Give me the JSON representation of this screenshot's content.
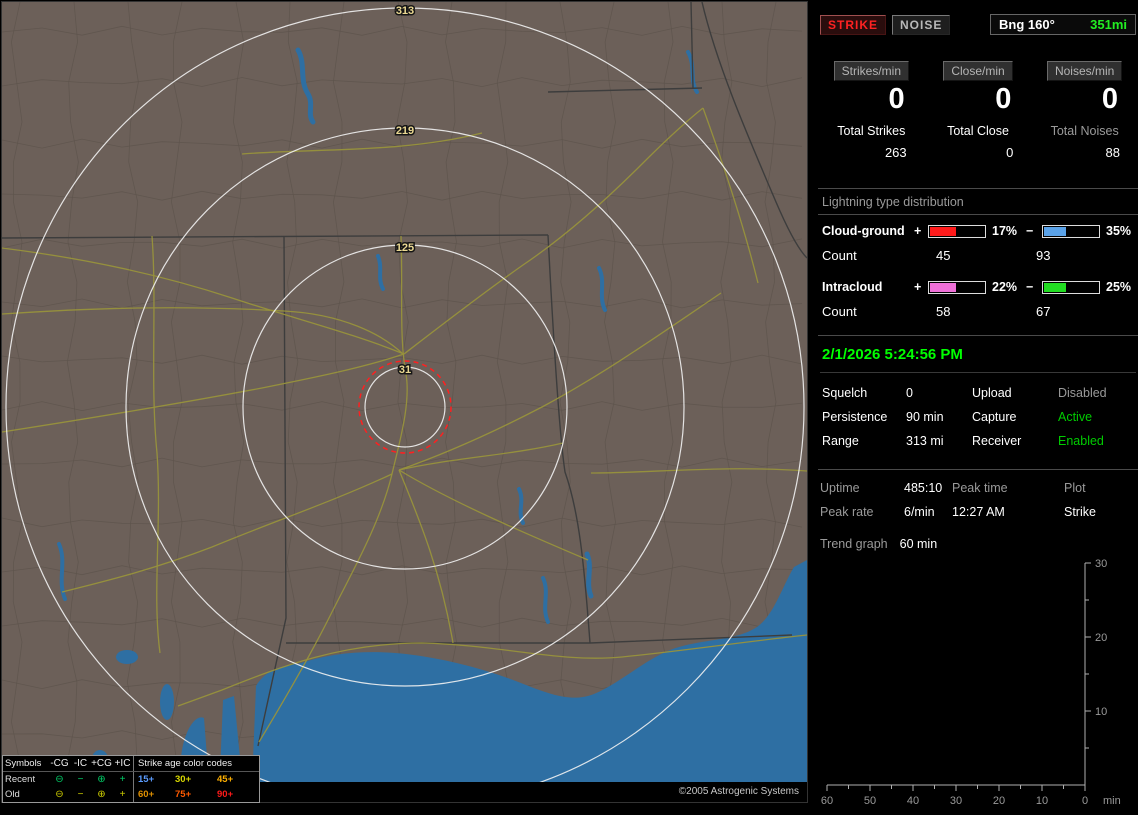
{
  "map": {
    "ring_labels": [
      "313",
      "219",
      "125",
      "31"
    ],
    "copyright": "©2005 Astrogenic Systems"
  },
  "legend": {
    "header_symbols": "Symbols",
    "symbol_cols": [
      "-CG",
      "-IC",
      "+CG",
      "+IC"
    ],
    "header_age": "Strike age color codes",
    "recent_color": "#00cc66",
    "old_color": "#cccc00",
    "rows": [
      {
        "label": "Recent",
        "symbols": [
          "⊖",
          "−",
          "⊕",
          "+"
        ],
        "ages": [
          {
            "t": "15+",
            "c": "#5a9cff"
          },
          {
            "t": "30+",
            "c": "#d8d800"
          },
          {
            "t": "45+",
            "c": "#ffb000"
          }
        ]
      },
      {
        "label": "Old",
        "symbols": [
          "⊖",
          "−",
          "⊕",
          "+"
        ],
        "ages": [
          {
            "t": "60+",
            "c": "#e09000"
          },
          {
            "t": "75+",
            "c": "#ff5a00"
          },
          {
            "t": "90+",
            "c": "#ff1a1a"
          }
        ]
      }
    ]
  },
  "panel": {
    "mode_buttons": {
      "strike": "STRIKE",
      "noise": "NOISE"
    },
    "bearing": {
      "label": "Bng 160°",
      "distance": "351mi"
    },
    "rates": [
      {
        "label": "Strikes/min",
        "value": "0",
        "total_label": "Total Strikes",
        "total_value": "263",
        "label_color": "#ffffff"
      },
      {
        "label": "Close/min",
        "value": "0",
        "total_label": "Total Close",
        "total_value": "0",
        "label_color": "#ffffff"
      },
      {
        "label": "Noises/min",
        "value": "0",
        "total_label": "Total Noises",
        "total_value": "88",
        "label_color": "#9a9a9a"
      }
    ],
    "distribution": {
      "title": "Lightning type distribution",
      "count_label": "Count",
      "plus": "+",
      "minus": "−",
      "rows": [
        {
          "label": "Cloud-ground",
          "pos": {
            "pct_label": "17%",
            "count": "45",
            "color": "#ff1a1a",
            "fill": 46
          },
          "neg": {
            "pct_label": "35%",
            "count": "93",
            "color": "#5aa2e8",
            "fill": 40
          }
        },
        {
          "label": "Intracloud",
          "pos": {
            "pct_label": "22%",
            "count": "58",
            "color": "#f070d8",
            "fill": 46
          },
          "neg": {
            "pct_label": "25%",
            "count": "67",
            "color": "#22dd22",
            "fill": 40
          }
        }
      ]
    },
    "datetime": "2/1/2026 5:24:56 PM",
    "settings_rows": [
      {
        "label": "Squelch",
        "value": "0",
        "label2": "Upload",
        "value2": "Disabled",
        "value2_color": "#9a9a9a"
      },
      {
        "label": "Persistence",
        "value": "90 min",
        "label2": "Capture",
        "value2": "Active",
        "value2_color": "#00cc00"
      },
      {
        "label": "Range",
        "value": "313 mi",
        "label2": "Receiver",
        "value2": "Enabled",
        "value2_color": "#00cc00"
      }
    ],
    "stats_rows": [
      {
        "c1": "Uptime",
        "c2": "485:10",
        "c3": "Peak time",
        "c4": "Plot"
      },
      {
        "c1": "Peak rate",
        "c2": "6/min",
        "c3": "12:27 AM",
        "c4": "Strike"
      }
    ],
    "trend": {
      "label": "Trend graph",
      "value": "60 min",
      "y_ticks": [
        "30",
        "20",
        "10"
      ],
      "x_ticks": [
        "60",
        "50",
        "40",
        "30",
        "20",
        "10",
        "0"
      ],
      "x_unit": "min"
    }
  }
}
